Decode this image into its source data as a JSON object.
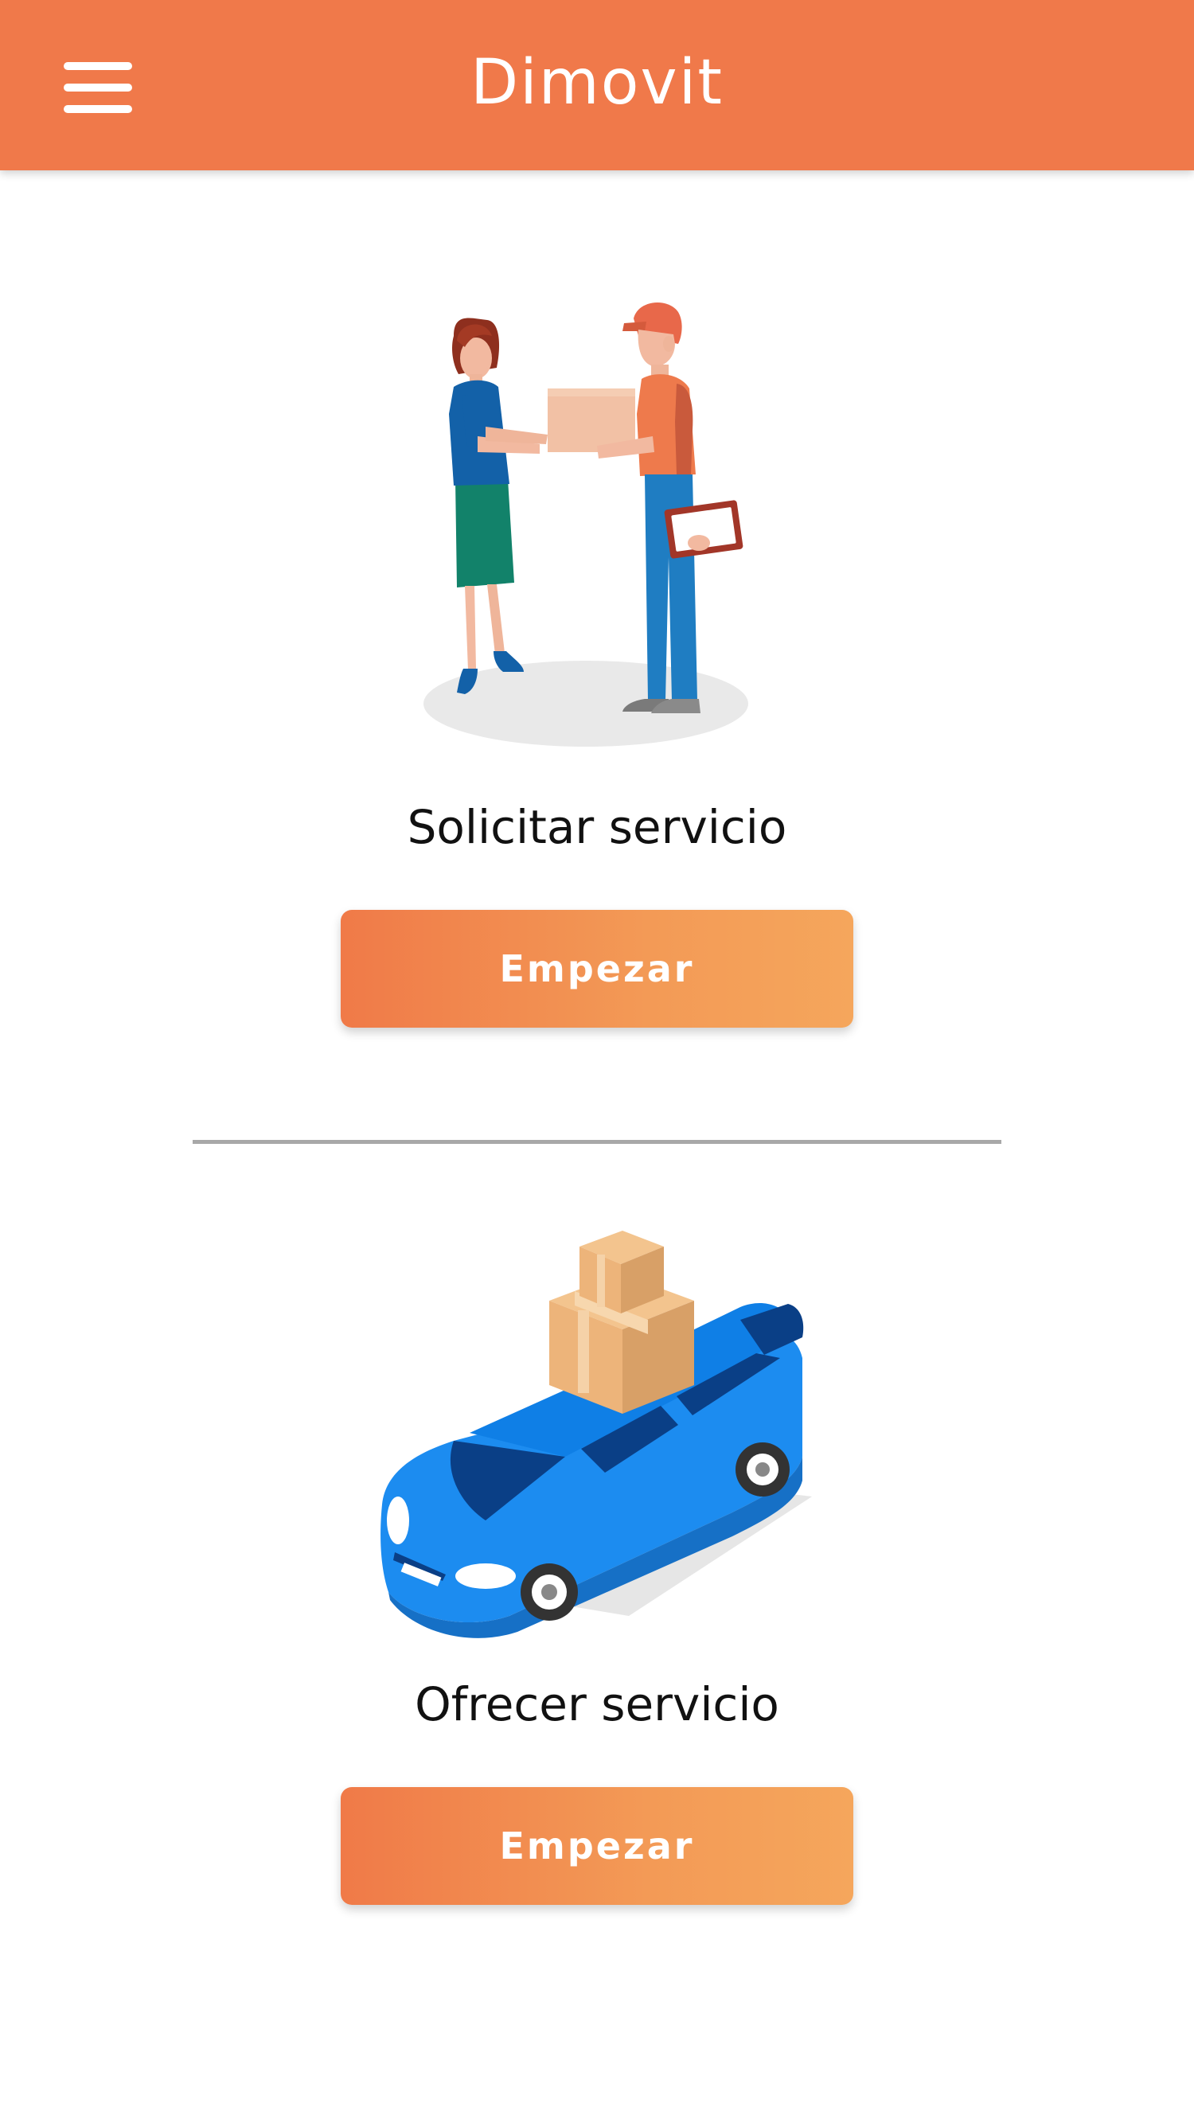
{
  "header": {
    "title": "Dimovit",
    "menu_icon": "hamburger-menu-icon",
    "background_color": "#F0794A"
  },
  "sections": [
    {
      "illustration": "delivery-handover-illustration",
      "label": "Solicitar servicio",
      "button_label": "Empezar"
    },
    {
      "illustration": "car-with-boxes-illustration",
      "label": "Ofrecer servicio",
      "button_label": "Empezar"
    }
  ],
  "colors": {
    "accent": "#F0794A",
    "button_gradient_start": "#F07A48",
    "button_gradient_end": "#F5A65C",
    "divider": "#A8A8A8"
  }
}
